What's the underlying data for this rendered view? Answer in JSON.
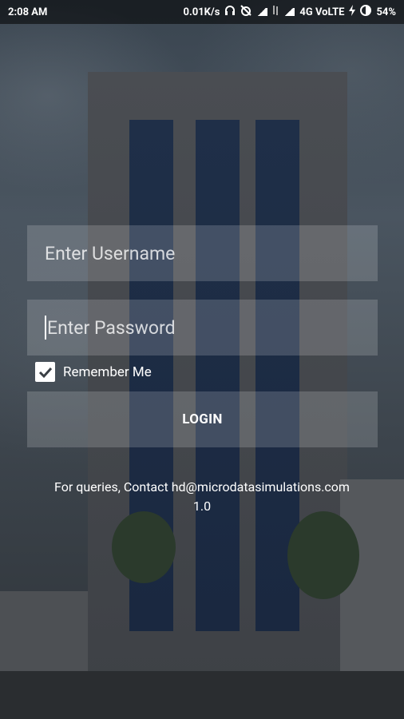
{
  "status_bar": {
    "time": "2:08 AM",
    "speed": "0.01K/s",
    "network": "4G VoLTE",
    "battery": "54%"
  },
  "form": {
    "username_placeholder": "Enter Username",
    "password_placeholder": "Enter Password",
    "remember_label": "Remember Me",
    "remember_checked": true,
    "login_label": "LOGIN"
  },
  "footer": {
    "contact": "For queries, Contact hd@microdatasimulations.com",
    "version": "1.0"
  },
  "colors": {
    "field_bg": "rgba(255,255,255,0.17)",
    "text": "#ffffff",
    "checkbox_check": "#3a3f45"
  },
  "icons": [
    "headphones-icon",
    "alarm-off-icon",
    "signal-icon",
    "charging-icon",
    "battery-icon",
    "check-icon"
  ]
}
